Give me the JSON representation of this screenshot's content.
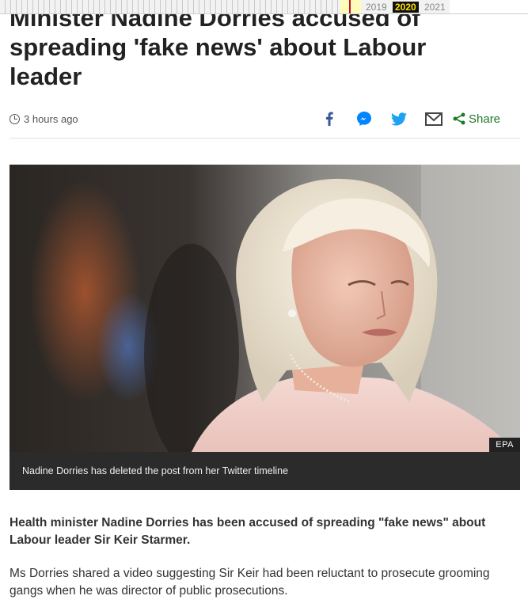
{
  "wayback": {
    "years": [
      "2019",
      "2020",
      "2021"
    ]
  },
  "article": {
    "headline": "Minister Nadine Dorries accused of spreading 'fake news' about Labour leader",
    "timestamp": "3 hours ago",
    "share_label": "Share",
    "image_credit": "EPA",
    "image_caption": "Nadine Dorries has deleted the post from her Twitter timeline",
    "intro": "Health minister Nadine Dorries has been accused of spreading \"fake news\" about Labour leader Sir Keir Starmer.",
    "paragraph_1": "Ms Dorries shared a video suggesting Sir Keir had been reluctant to prosecute grooming gangs when he was director of public prosecutions."
  },
  "share_icons": [
    "facebook-icon",
    "messenger-icon",
    "twitter-icon",
    "email-icon",
    "share-icon"
  ],
  "colors": {
    "share_green": "#1f7a29",
    "icon_blue": "#3b5998",
    "messenger_blue": "#0084ff",
    "twitter_blue": "#1da1f2",
    "wayback_year_bg": "#111111",
    "wayback_year_text": "#ffe100"
  }
}
